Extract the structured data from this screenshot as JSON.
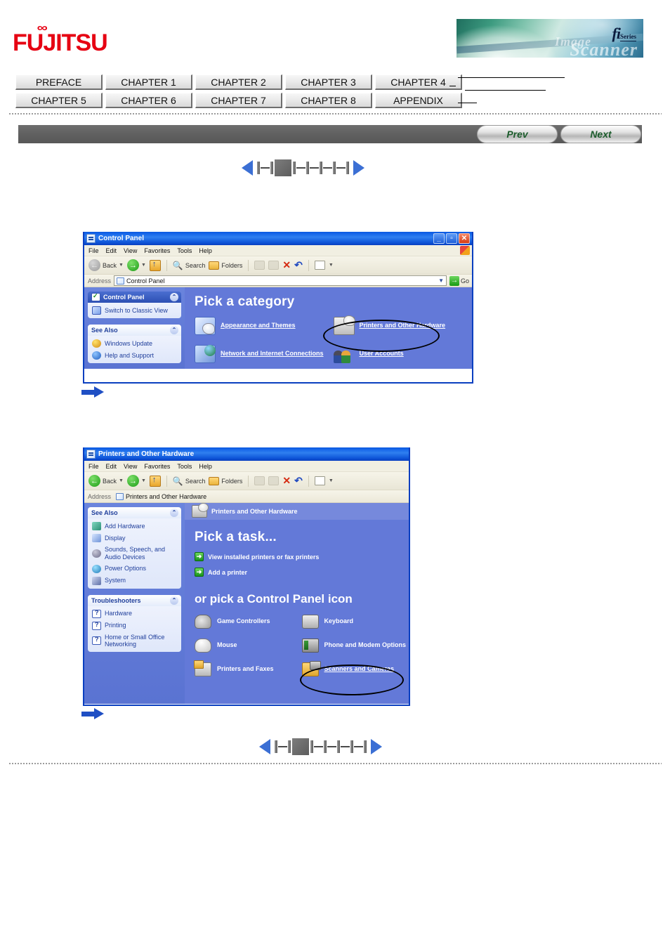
{
  "header": {
    "logo_text": "FUJITSU",
    "logo_infinity": "∞",
    "logo_color": "#e60012",
    "banner": {
      "fi_text": "fi",
      "series_text": "Series",
      "image_word": "Image",
      "scanner_word": "Scanner"
    }
  },
  "chapter_tabs": {
    "row1": [
      "PREFACE",
      "CHAPTER 1",
      "CHAPTER 2",
      "CHAPTER 3",
      "CHAPTER 4"
    ],
    "row2": [
      "CHAPTER 5",
      "CHAPTER 6",
      "CHAPTER 7",
      "CHAPTER 8",
      "APPENDIX"
    ]
  },
  "navbar": {
    "prev_label": "Prev",
    "next_label": "Next"
  },
  "pager": {
    "current_index": 2,
    "total": 6,
    "prev_arrow": "left-triangle",
    "next_arrow": "right-triangle"
  },
  "window1": {
    "title": "Control Panel",
    "menu": [
      "File",
      "Edit",
      "View",
      "Favorites",
      "Tools",
      "Help"
    ],
    "toolbar": {
      "back_label": "Back",
      "search_label": "Search",
      "folders_label": "Folders"
    },
    "address": {
      "label": "Address",
      "value": "Control Panel",
      "go_label": "Go"
    },
    "sidebar": {
      "panel1_title": "Control Panel",
      "panel1_links": [
        "Switch to Classic View"
      ],
      "panel2_title": "See Also",
      "panel2_links": [
        "Windows Update",
        "Help and Support"
      ]
    },
    "main": {
      "heading": "Pick a category",
      "categories": [
        "Appearance and Themes",
        "Printers and Other Hardware",
        "Network and Internet Connections",
        "User Accounts"
      ],
      "circled_item": "Printers and Other Hardware"
    }
  },
  "window2": {
    "title": "Printers and Other Hardware",
    "menu": [
      "File",
      "Edit",
      "View",
      "Favorites",
      "Tools",
      "Help"
    ],
    "toolbar": {
      "back_label": "Back",
      "search_label": "Search",
      "folders_label": "Folders"
    },
    "address": {
      "label": "Address",
      "value": "Printers and Other Hardware"
    },
    "sidebar": {
      "panel1_title": "See Also",
      "panel1_links": [
        "Add Hardware",
        "Display",
        "Sounds, Speech, and Audio Devices",
        "Power Options",
        "System"
      ],
      "panel2_title": "Troubleshooters",
      "panel2_links": [
        "Hardware",
        "Printing",
        "Home or Small Office Networking"
      ]
    },
    "main": {
      "header_strip": "Printers and Other Hardware",
      "heading": "Pick a task...",
      "tasks": [
        "View installed printers or fax printers",
        "Add a printer"
      ],
      "subheading": "or pick a Control Panel icon",
      "icons": [
        "Game Controllers",
        "Keyboard",
        "Mouse",
        "Phone and Modem Options",
        "Printers and Faxes",
        "Scanners and Cameras"
      ],
      "circled_item": "Scanners and Cameras"
    }
  }
}
